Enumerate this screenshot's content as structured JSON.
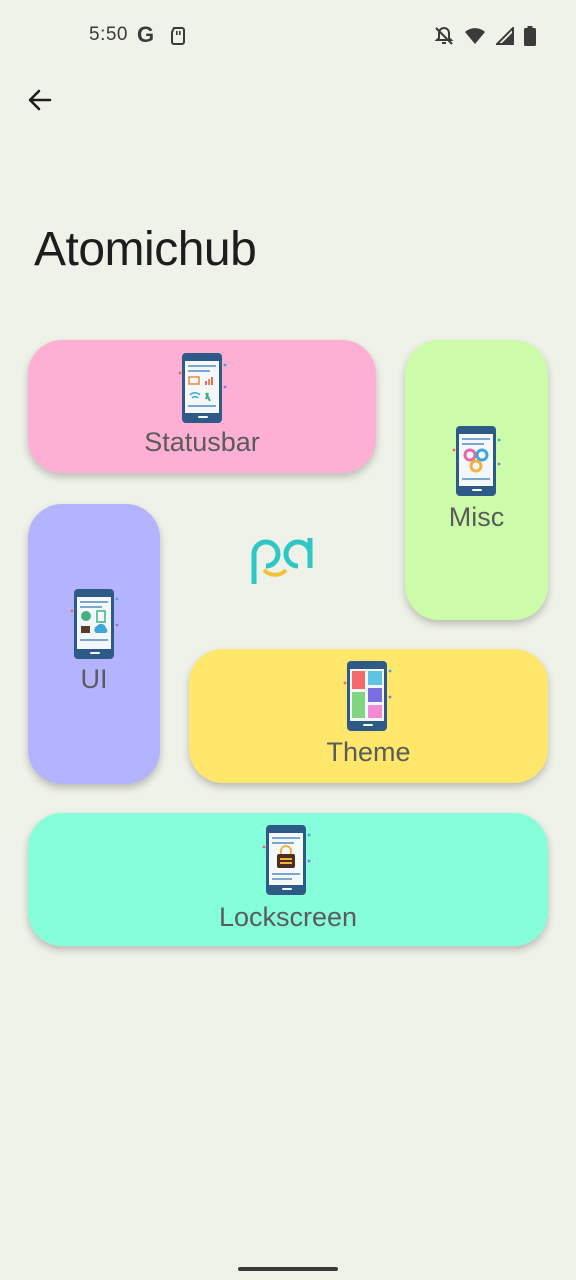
{
  "status_bar": {
    "time": "5:50",
    "icons": [
      "google-g-icon",
      "sd-card-icon",
      "notifications-off-icon",
      "wifi-icon",
      "signal-icon",
      "battery-icon"
    ]
  },
  "header": {
    "title": "Atomichub",
    "back_icon": "arrow-back-icon"
  },
  "tiles": {
    "statusbar": {
      "label": "Statusbar",
      "color": "#feb0d4"
    },
    "misc": {
      "label": "Misc",
      "color": "#ccfcaa"
    },
    "ui": {
      "label": "UI",
      "color": "#b3b4fd"
    },
    "theme": {
      "label": "Theme",
      "color": "#ffe76b"
    },
    "lockscreen": {
      "label": "Lockscreen",
      "color": "#87fedb"
    }
  },
  "logo": {
    "icon": "pd-logo"
  }
}
